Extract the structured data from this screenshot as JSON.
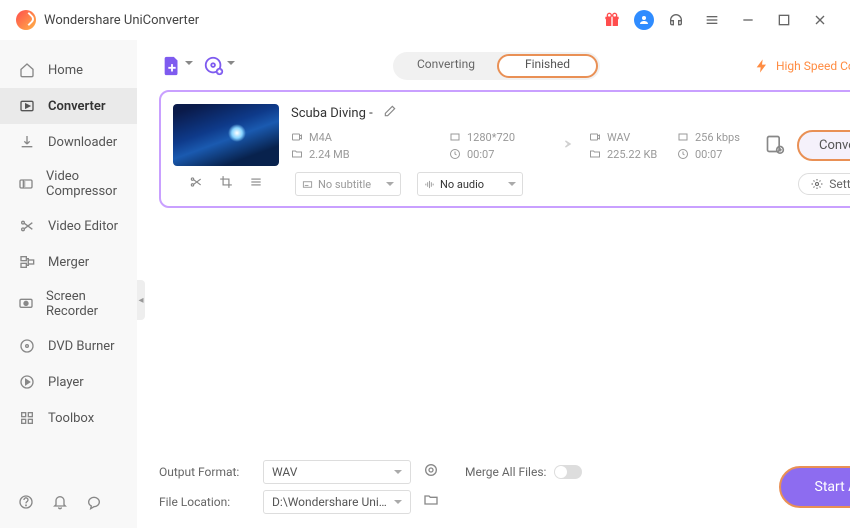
{
  "app": {
    "title": "Wondershare UniConverter"
  },
  "window": {
    "gift_icon": "gift",
    "avatar_letter": "",
    "headset": "support",
    "menu": "menu",
    "min": "min",
    "max": "max",
    "close": "close"
  },
  "sidebar": {
    "items": [
      {
        "label": "Home"
      },
      {
        "label": "Converter"
      },
      {
        "label": "Downloader"
      },
      {
        "label": "Video Compressor"
      },
      {
        "label": "Video Editor"
      },
      {
        "label": "Merger"
      },
      {
        "label": "Screen Recorder"
      },
      {
        "label": "DVD Burner"
      },
      {
        "label": "Player"
      },
      {
        "label": "Toolbox"
      }
    ]
  },
  "tabs": {
    "converting": "Converting",
    "finished": "Finished"
  },
  "highspeed": {
    "label": "High Speed Conversion"
  },
  "file": {
    "name": "Scuba Diving -",
    "src": {
      "format": "M4A",
      "res": "1280*720",
      "size": "2.24 MB",
      "dur": "00:07"
    },
    "dst": {
      "format": "WAV",
      "bitrate": "256 kbps",
      "size": "225.22 KB",
      "dur": "00:07"
    },
    "subtitle": "No subtitle",
    "audio": "No audio",
    "settings": "Settings",
    "convert": "Convert"
  },
  "footer": {
    "output_label": "Output Format:",
    "output_value": "WAV",
    "location_label": "File Location:",
    "location_value": "D:\\Wondershare UniConverter",
    "merge_label": "Merge All Files:",
    "start": "Start All"
  }
}
